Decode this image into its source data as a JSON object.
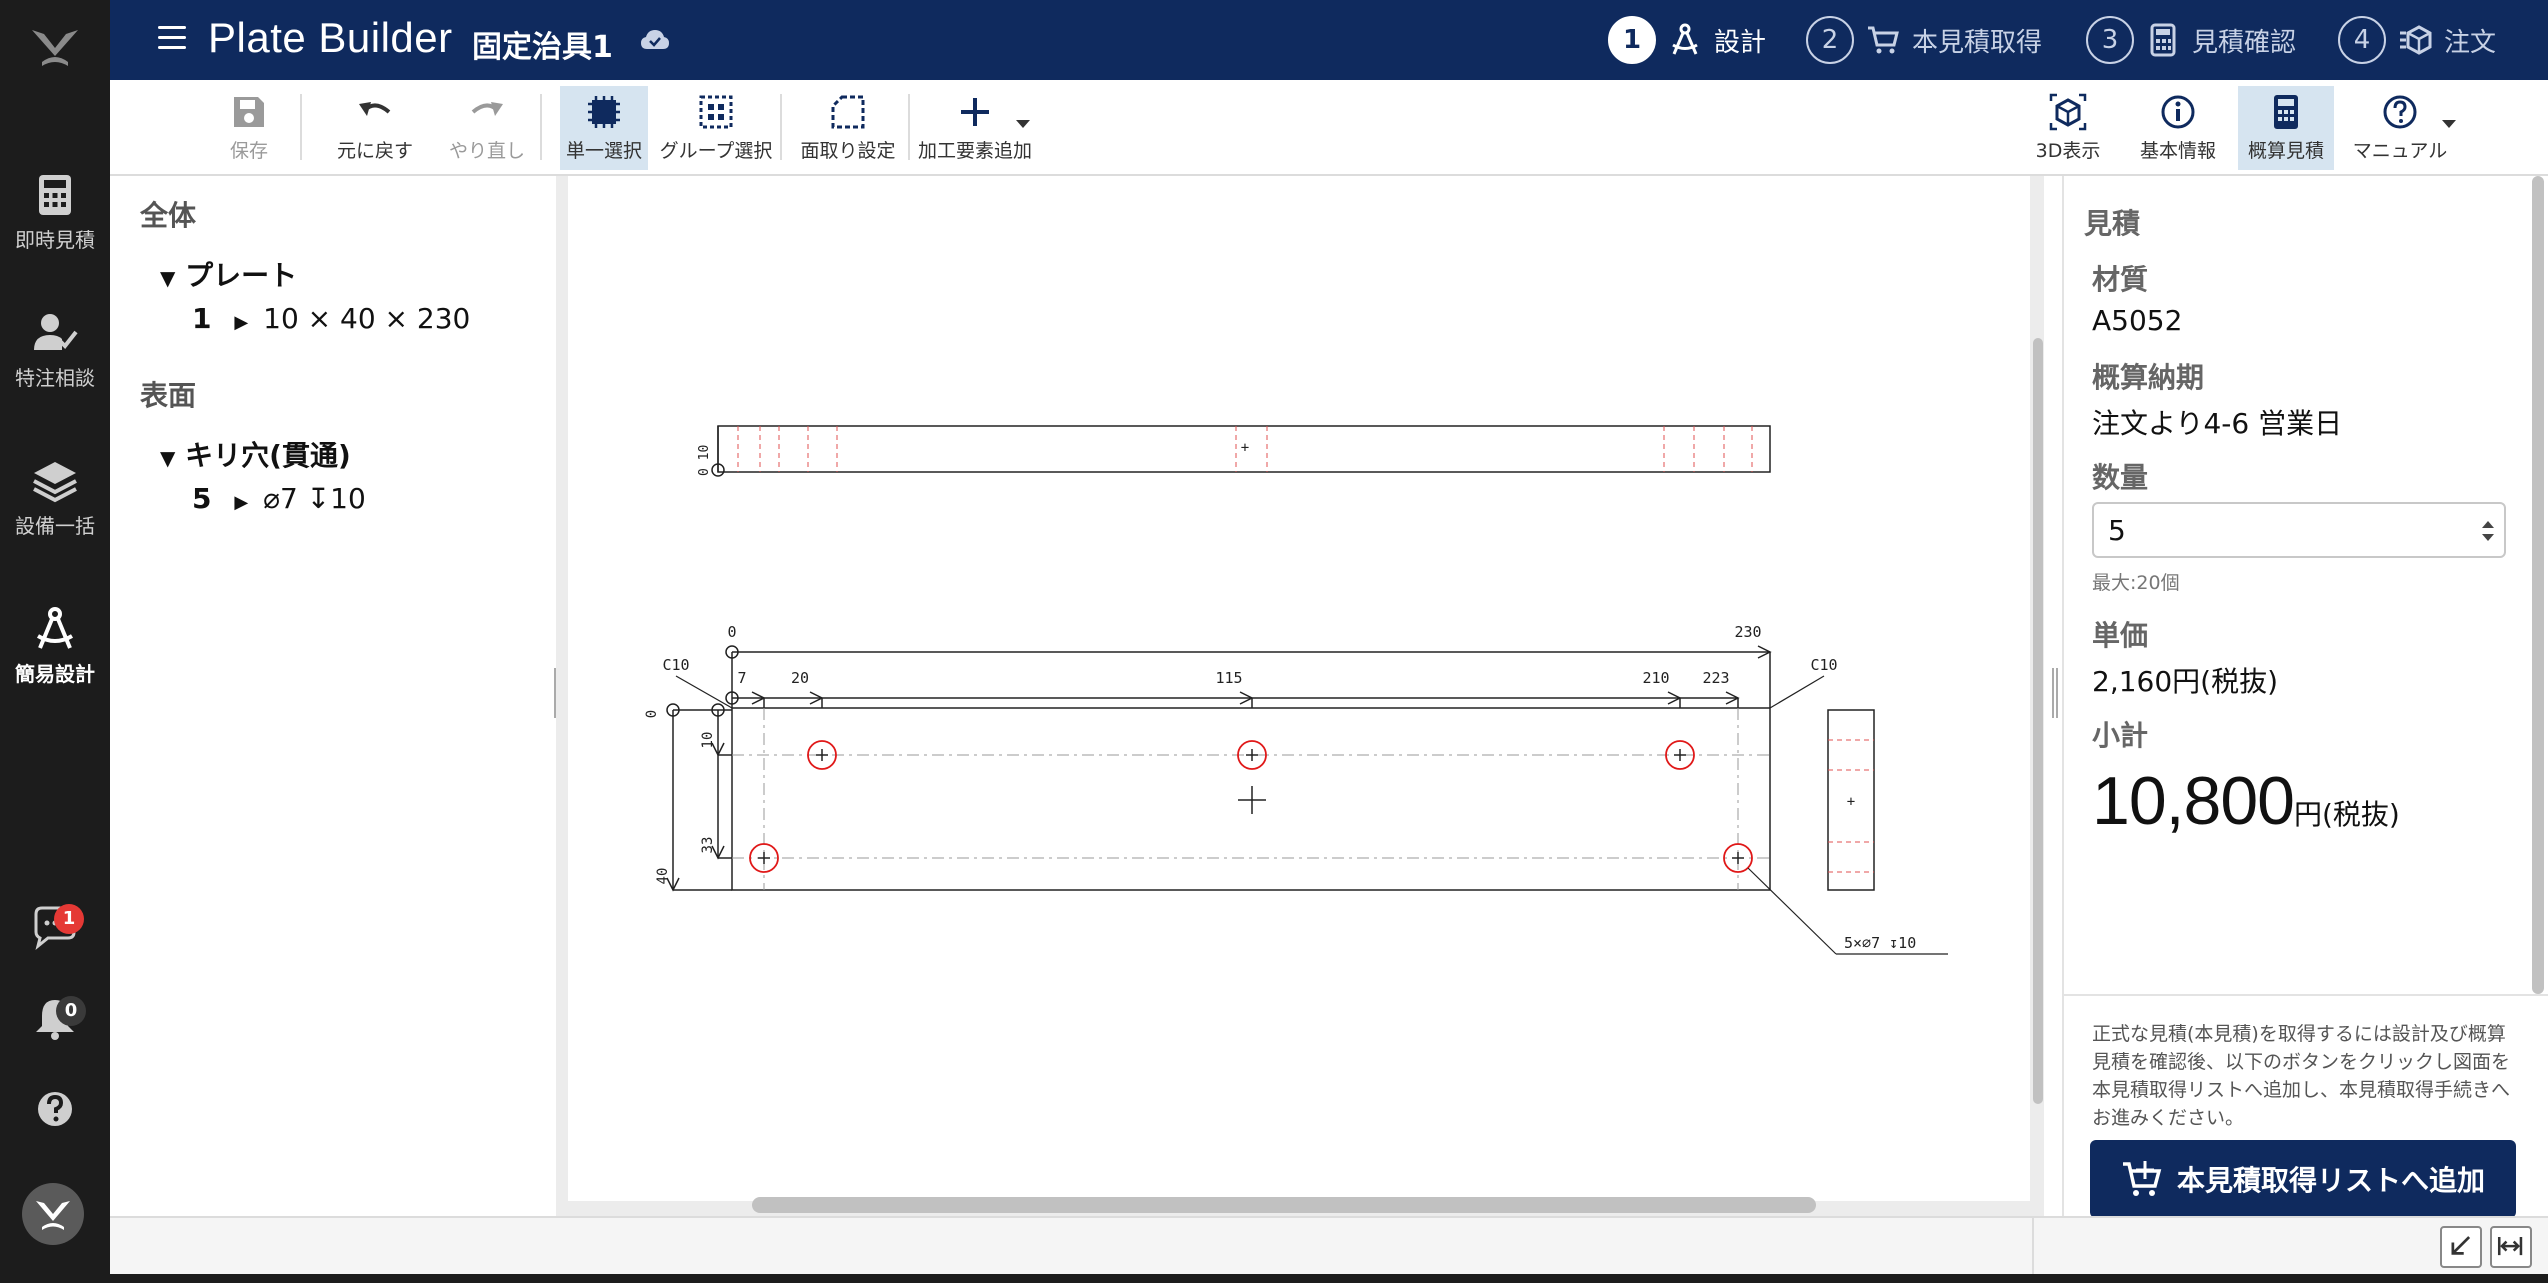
{
  "rail": {
    "items": [
      {
        "label": "即時見積",
        "icon": "calculator-icon"
      },
      {
        "label": "特注相談",
        "icon": "user-check-icon"
      },
      {
        "label": "設備一括",
        "icon": "layers-icon"
      },
      {
        "label": "簡易設計",
        "icon": "compass-draw-icon"
      }
    ],
    "chat_badge": "1",
    "bell_badge": "0"
  },
  "header": {
    "app_title": "Plate Builder",
    "doc_title": "固定治具1",
    "steps": [
      {
        "num": "1",
        "label": "設計"
      },
      {
        "num": "2",
        "label": "本見積取得"
      },
      {
        "num": "3",
        "label": "見積確認"
      },
      {
        "num": "4",
        "label": "注文"
      }
    ]
  },
  "toolbar": {
    "save": "保存",
    "undo": "元に戻す",
    "redo": "やり直し",
    "single_select": "単一選択",
    "group_select": "グループ選択",
    "chamfer": "面取り設定",
    "add_feature": "加工要素追加",
    "view3d": "3D表示",
    "basic_info": "基本情報",
    "estimate": "概算見積",
    "manual": "マニュアル"
  },
  "tree": {
    "section_all": "全体",
    "plate_group": "プレート",
    "plate_count": "1",
    "plate_dims": "10 × 40 × 230",
    "section_surface": "表面",
    "hole_group": "キリ穴(貫通)",
    "hole_count": "5",
    "hole_spec": "⌀7 ↧10"
  },
  "drawing": {
    "top_dim_0": "0",
    "top_dim_230": "230",
    "dim_7": "7",
    "dim_20": "20",
    "dim_115": "115",
    "dim_210": "210",
    "dim_223": "223",
    "chamfer_left": "C10",
    "chamfer_right": "C10",
    "side_0": "0",
    "side_10": "10",
    "side_33": "33",
    "side_40": "40",
    "thick_label": "0  10",
    "hole_callout": "5×⌀7 ↧10"
  },
  "estimate": {
    "heading": "見積",
    "material_label": "材質",
    "material": "A5052",
    "leadtime_label": "概算納期",
    "leadtime": "注文より4-6 営業日",
    "qty_label": "数量",
    "qty": "5",
    "qty_max": "最大:20個",
    "unit_price_label": "単価",
    "unit_price": "2,160円(税抜)",
    "subtotal_label": "小計",
    "subtotal": "10,800",
    "subtotal_unit": "円(税抜)",
    "note": "正式な見積(本見積)を取得するには設計及び概算見積を確認後、以下のボタンをクリックし図面を本見積取得リストへ追加し、本見積取得手続きへお進みください。",
    "cta": "本見積取得リストへ追加"
  },
  "colors": {
    "navy": "#0f2a5e",
    "rail": "#1c1c1c",
    "hole_red": "#e01818",
    "badge_red": "#e53935"
  }
}
